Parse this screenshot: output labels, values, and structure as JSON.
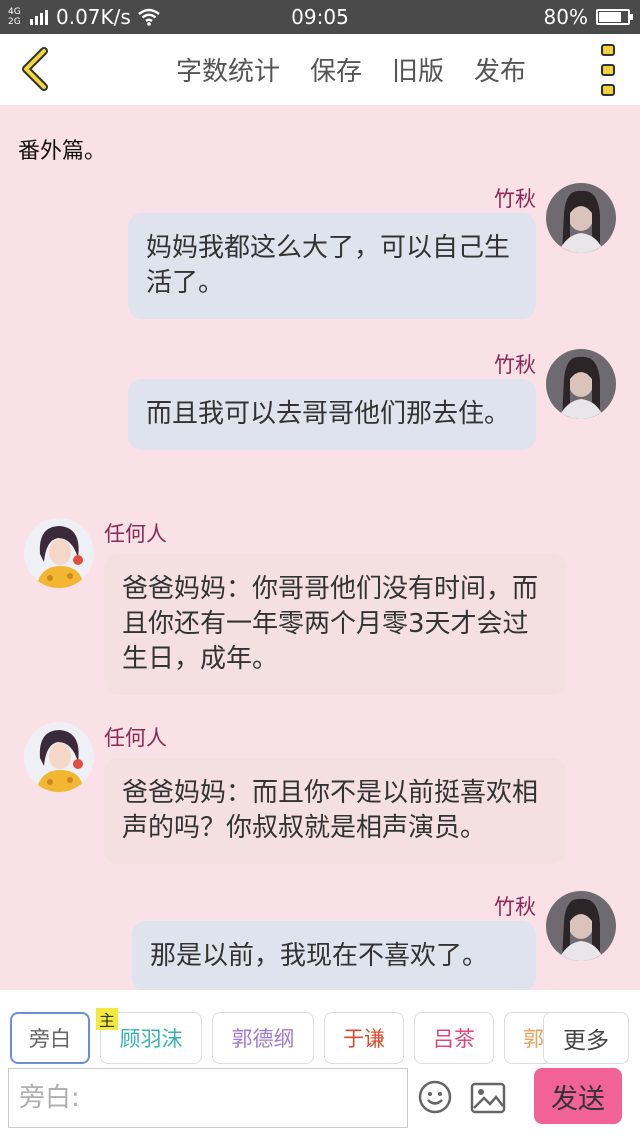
{
  "status_bar": {
    "network": "4G 2G",
    "speed": "0.07K/s",
    "time": "09:05",
    "battery": "80%",
    "battery_level": 0.8
  },
  "header": {
    "actions": [
      "字数统计",
      "保存",
      "旧版",
      "发布"
    ]
  },
  "chat": {
    "intro": "番外篇。",
    "messages": [
      {
        "side": "right",
        "name": "竹秋",
        "text": "妈妈我都这么大了，可以自己生活了。"
      },
      {
        "side": "right",
        "name": "竹秋",
        "text": "而且我可以去哥哥他们那去住。"
      },
      {
        "side": "left",
        "name": "任何人",
        "text": "爸爸妈妈：你哥哥他们没有时间，而且你还有一年零两个月零3天才会过生日，成年。"
      },
      {
        "side": "left",
        "name": "任何人",
        "text": "爸爸妈妈：而且你不是以前挺喜欢相声的吗？你叔叔就是相声演员。"
      },
      {
        "side": "right",
        "name": "竹秋",
        "text": "那是以前，我现在不喜欢了。"
      }
    ]
  },
  "roles": {
    "items": [
      {
        "label": "旁白",
        "color": "#666666"
      },
      {
        "label": "顾羽沫",
        "color": "#39b3b0"
      },
      {
        "label": "郭德纲",
        "color": "#a07bd0"
      },
      {
        "label": "于谦",
        "color": "#e04a2c"
      },
      {
        "label": "吕茶",
        "color": "#e0457e"
      },
      {
        "label": "郭",
        "color": "#e6a35a"
      }
    ],
    "badge": "主",
    "more_label": "更多"
  },
  "composer": {
    "placeholder": "旁白:",
    "send_label": "发送"
  },
  "colors": {
    "background": "#fae1e7",
    "right_bubble": "#dfe3ee",
    "left_bubble": "#f4dfe1",
    "name": "#8a2a55",
    "send": "#f06394"
  }
}
